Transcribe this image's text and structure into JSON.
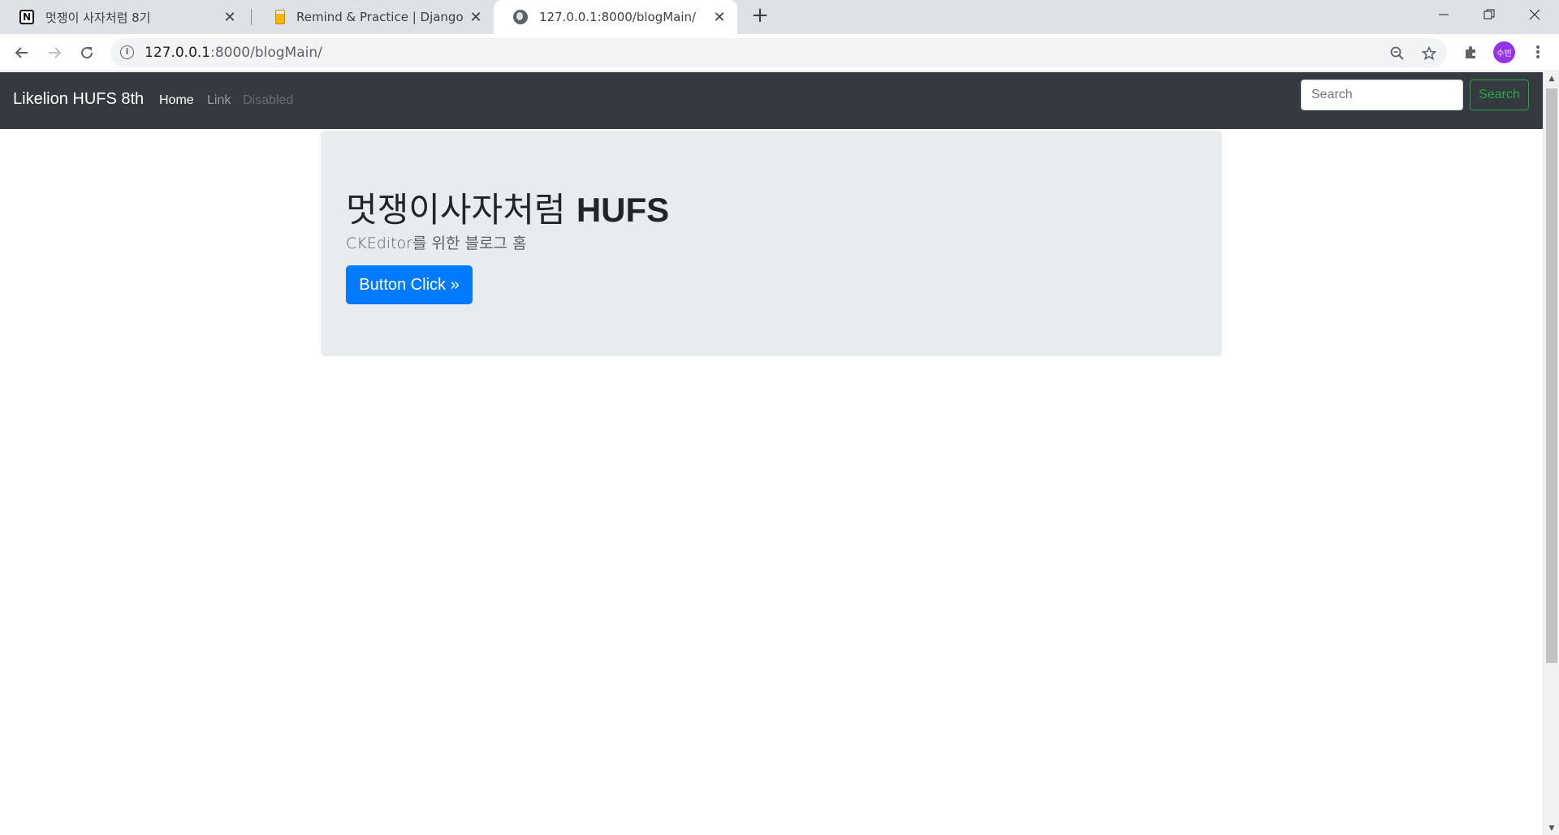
{
  "browser": {
    "tabs": [
      {
        "title": "멋쟁이 사자처럼 8기",
        "icon": "notion-icon"
      },
      {
        "title": "Remind & Practice | Django Blog",
        "icon": "beer-icon"
      },
      {
        "title": "127.0.0.1:8000/blogMain/",
        "icon": "globe-icon",
        "active": true
      }
    ],
    "close_glyph": "✕",
    "new_tab_glyph": "+",
    "url_host": "127.0.0.1",
    "url_rest": ":8000/blogMain/",
    "profile_initials": "수빈"
  },
  "site": {
    "brand": "Likelion HUFS 8th",
    "nav": {
      "home": "Home",
      "link": "Link",
      "disabled": "Disabled"
    },
    "search": {
      "placeholder": "Search",
      "button": "Search"
    },
    "jumbotron": {
      "title_korean": "멋쟁이사자처럼",
      "title_bold": "HUFS",
      "subtitle": "CKEditor를 위한 블로그 홈",
      "button": "Button Click »"
    }
  },
  "colors": {
    "navbar": "#343a40",
    "jumbotron": "#e9ecef",
    "primary": "#007bff",
    "success": "#28a745"
  }
}
